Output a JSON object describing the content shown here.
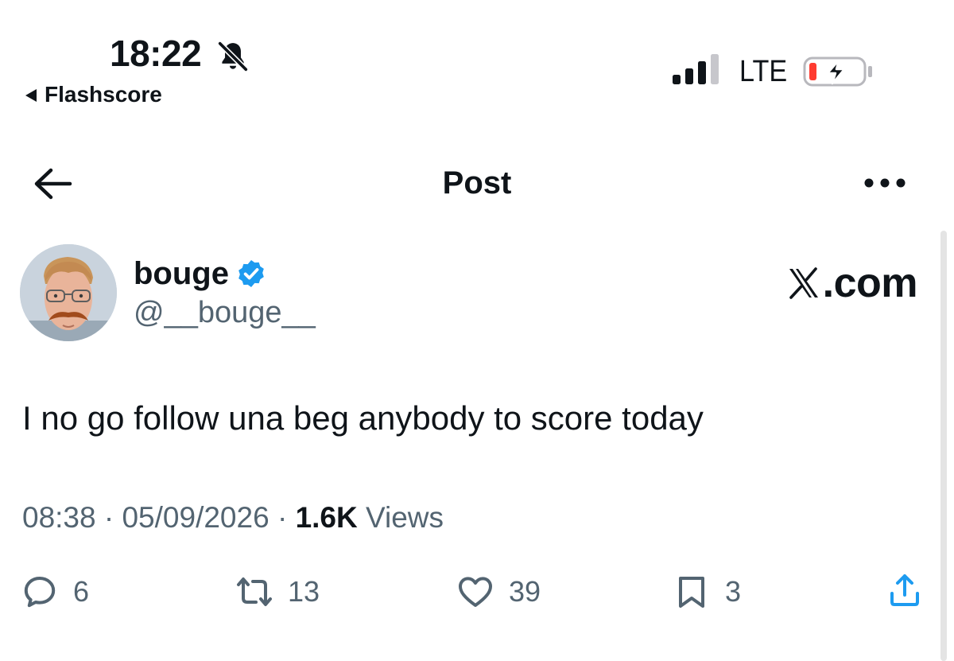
{
  "status_bar": {
    "time": "18:22",
    "back_app": "Flashscore",
    "network": "LTE",
    "icons": [
      "bell-slash-icon",
      "signal-icon",
      "battery-charging-icon"
    ],
    "battery_color": "#ff3b30"
  },
  "nav": {
    "title": "Post",
    "icons": [
      "back-arrow-icon",
      "more-icon"
    ]
  },
  "post": {
    "author": {
      "name": "bouge",
      "handle": "@__bouge__",
      "verified": true,
      "verified_color": "#1d9bf0"
    },
    "watermark": ".com",
    "text": "I no go follow una beg anybody to score today",
    "time": "08:38",
    "date": "05/09/2026",
    "separator": "·",
    "views_count": "1.6K",
    "views_label": "Views"
  },
  "actions": {
    "replies": "6",
    "reposts": "13",
    "likes": "39",
    "bookmarks": "3",
    "icons": [
      "reply-icon",
      "repost-icon",
      "like-icon",
      "bookmark-icon",
      "share-icon"
    ]
  },
  "colors": {
    "text": "#0f1419",
    "secondary": "#536471",
    "accent": "#1d9bf0"
  }
}
